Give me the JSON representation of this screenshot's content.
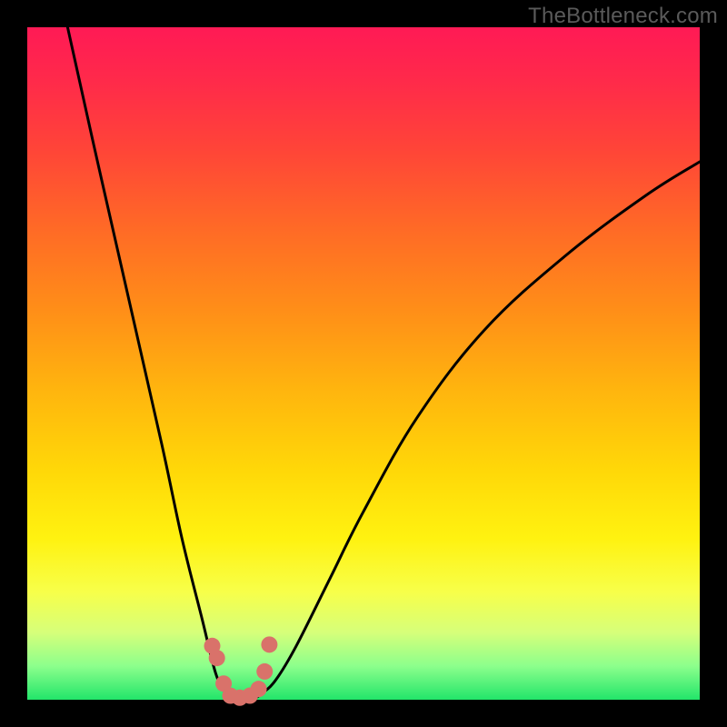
{
  "watermark": "TheBottleneck.com",
  "chart_data": {
    "type": "line",
    "title": "",
    "xlabel": "",
    "ylabel": "",
    "xlim": [
      0,
      100
    ],
    "ylim": [
      0,
      100
    ],
    "gradient_meaning": "green (bottom) = good / low bottleneck, red (top) = bad / high bottleneck",
    "series": [
      {
        "name": "left_branch",
        "x": [
          6,
          10,
          15,
          20,
          23,
          26,
          28,
          29.5,
          30.5
        ],
        "values": [
          100,
          82,
          60,
          38,
          24,
          12,
          4,
          1,
          0
        ]
      },
      {
        "name": "right_branch",
        "x": [
          33.5,
          35,
          37,
          40,
          45,
          50,
          58,
          68,
          80,
          92,
          100
        ],
        "values": [
          0,
          1,
          3,
          8,
          18,
          28,
          42,
          55,
          66,
          75,
          80
        ]
      },
      {
        "name": "valley_floor",
        "x": [
          30.5,
          31.5,
          32.5,
          33.5
        ],
        "values": [
          0,
          0,
          0,
          0
        ]
      }
    ],
    "markers": {
      "name": "dots",
      "color": "#d9726a",
      "x": [
        27.5,
        28.2,
        29.2,
        30.2,
        31.6,
        33.1,
        34.4,
        35.3,
        36.0
      ],
      "values": [
        8.0,
        6.2,
        2.4,
        0.6,
        0.3,
        0.6,
        1.6,
        4.2,
        8.2
      ]
    },
    "valley_min_x": 32,
    "annotations": []
  }
}
